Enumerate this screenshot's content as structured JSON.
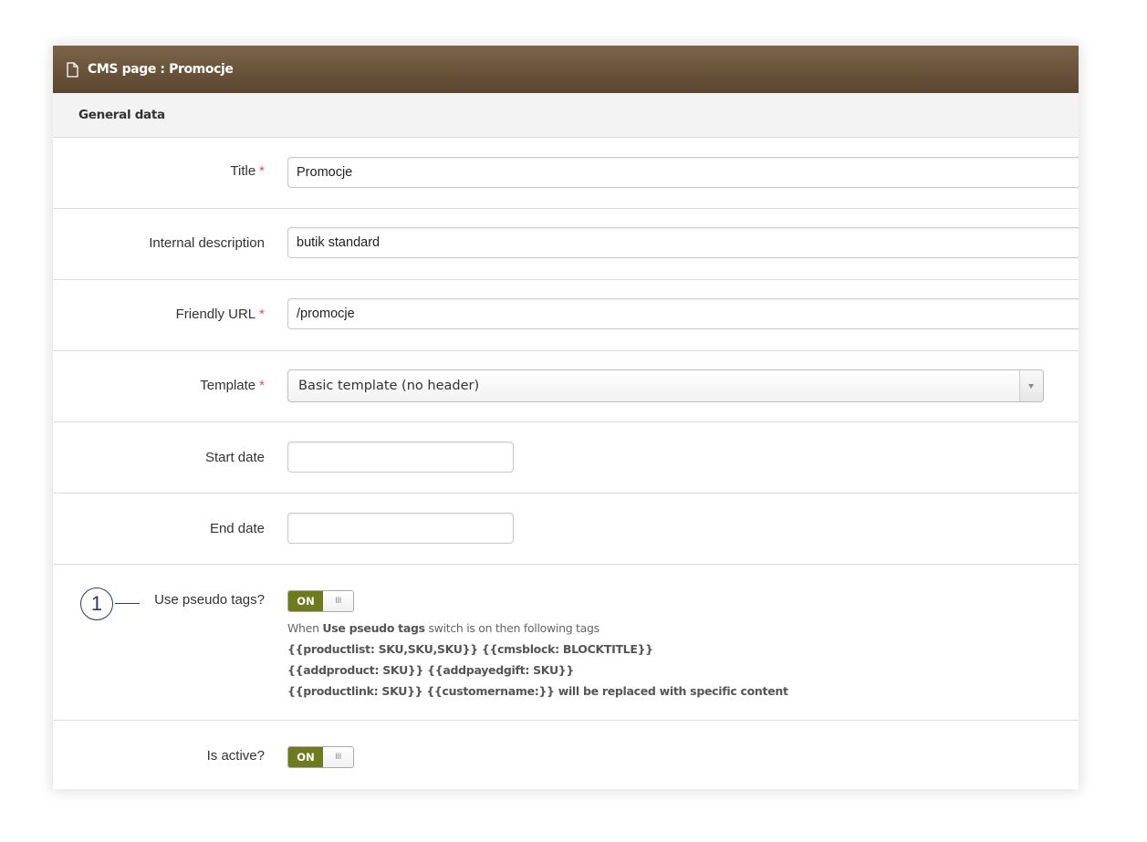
{
  "window": {
    "title": "CMS page : Promocje",
    "icon": "document-icon"
  },
  "section": {
    "title": "General data"
  },
  "fields": {
    "title": {
      "label": "Title",
      "required_mark": "*",
      "value": "Promocje"
    },
    "internal_description": {
      "label": "Internal description",
      "value": "butik standard"
    },
    "friendly_url": {
      "label": "Friendly URL",
      "required_mark": "*",
      "value": "/promocje"
    },
    "template": {
      "label": "Template",
      "required_mark": "*",
      "value": "Basic template (no header)"
    },
    "start_date": {
      "label": "Start date",
      "value": ""
    },
    "end_date": {
      "label": "End date",
      "value": ""
    },
    "use_pseudo_tags": {
      "label": "Use pseudo tags?",
      "toggle_on": "ON",
      "toggle_handle": "III",
      "help_prefix": "When",
      "help_bold": "Use pseudo tags",
      "help_suffix": "switch is on then following tags",
      "help_line2": "{{productlist: SKU,SKU,SKU}} {{cmsblock: BLOCKTITLE}}",
      "help_line3": "{{addproduct: SKU}} {{addpayedgift: SKU}}",
      "help_line4": "{{productlink: SKU}} {{customername:}} will be replaced with specific content"
    },
    "is_active": {
      "label": "Is active?",
      "toggle_on": "ON",
      "toggle_handle": "III"
    }
  },
  "callout": {
    "number": "1"
  },
  "colors": {
    "titlebar": "#6b5239",
    "toggle_on": "#6f7a1f",
    "required": "#d9534f",
    "callout": "#2a3a6a"
  }
}
